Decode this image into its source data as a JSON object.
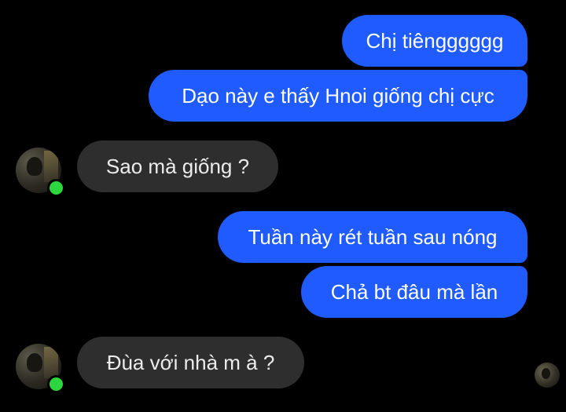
{
  "messages": [
    {
      "direction": "outgoing",
      "text": "Chị tiêngggggg"
    },
    {
      "direction": "outgoing",
      "text": "Dạo này e thấy Hnoi giống chị cực"
    },
    {
      "direction": "incoming",
      "text": "Sao mà giống ?"
    },
    {
      "direction": "outgoing",
      "text": "Tuần này rét tuần sau nóng"
    },
    {
      "direction": "outgoing",
      "text": "Chả bt đâu mà lần"
    },
    {
      "direction": "incoming",
      "text": "Đùa với nhà m à ?"
    }
  ],
  "contact": {
    "status": "online",
    "status_color": "#2bd63e"
  },
  "colors": {
    "outgoing_bubble": "#1f5bff",
    "incoming_bubble": "#2e2e2e",
    "background": "#000000"
  },
  "read_receipt": {
    "icon": "seen-avatar-icon"
  }
}
